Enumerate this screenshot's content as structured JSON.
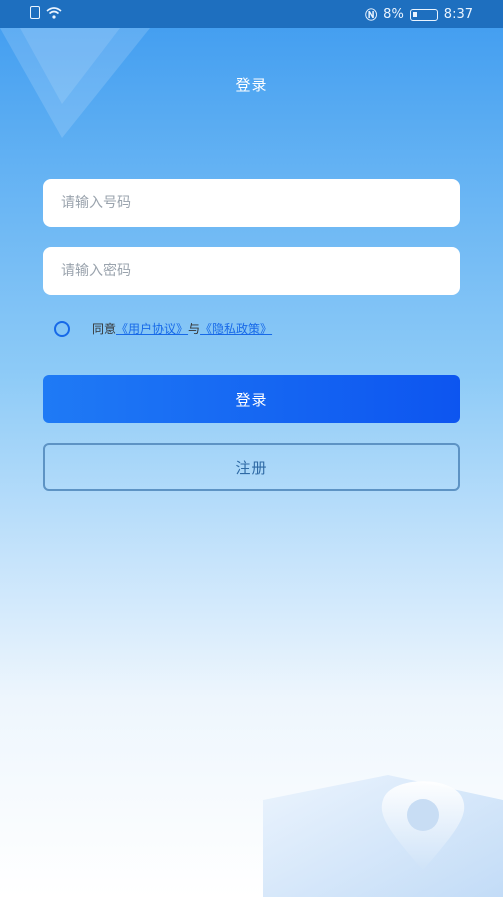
{
  "status_bar": {
    "battery_percent": "8%",
    "time": "8:37"
  },
  "header": {
    "title": "登录"
  },
  "form": {
    "phone_placeholder": "请输入号码",
    "password_placeholder": "请输入密码",
    "agree_prefix": "同意",
    "user_agreement": "《用户协议》",
    "agree_and": "与",
    "privacy_policy": "《隐私政策》",
    "login_label": "登录",
    "register_label": "注册"
  },
  "colors": {
    "accent": "#1769e8",
    "status_bar": "#1e6fbf"
  }
}
